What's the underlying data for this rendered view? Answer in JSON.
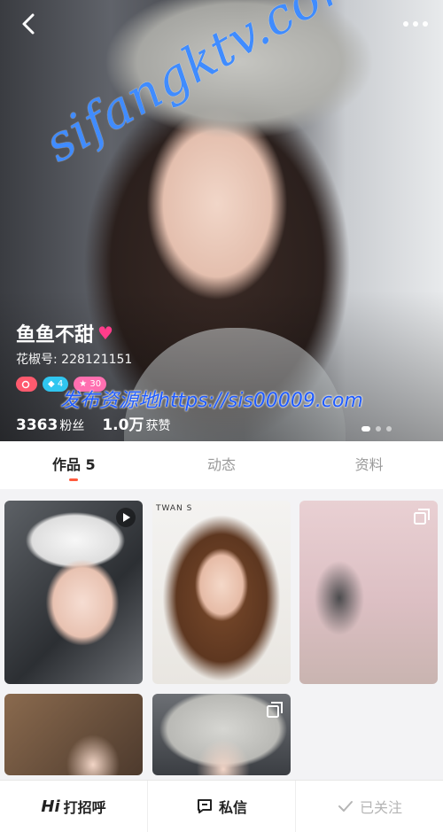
{
  "watermarks": {
    "diagonal": "sifangktv.com",
    "banner": "发布资源地https://sis00009.com"
  },
  "profile": {
    "name": "鱼鱼不甜",
    "id_label": "花椒号: 228121151",
    "badges": [
      "",
      "4",
      "30"
    ],
    "fans_count": "3363",
    "fans_label": "粉丝",
    "likes_count": "1.0万",
    "likes_label": "获赞"
  },
  "carousel": {
    "pages": 3,
    "active": 0
  },
  "tabs": [
    {
      "label": "作品 5",
      "active": true
    },
    {
      "label": "动态",
      "active": false
    },
    {
      "label": "资料",
      "active": false
    }
  ],
  "grid": {
    "cell2_caption": "TWAN S"
  },
  "bottom_bar": {
    "greet_prefix": "Hi",
    "greet_label": "打招呼",
    "message_label": "私信",
    "follow_label": "已关注"
  },
  "colors": {
    "accent": "#ff5a3c",
    "heart": "#ff3d8b",
    "watermark": "#1e78ff"
  }
}
